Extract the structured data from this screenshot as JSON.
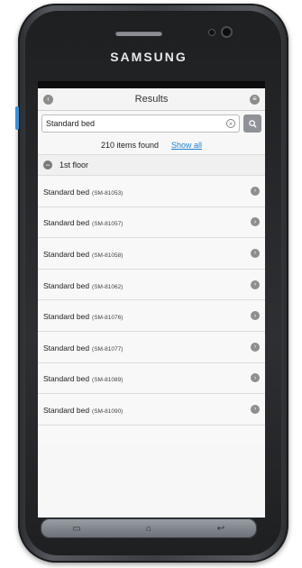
{
  "device": {
    "brand": "SAMSUNG"
  },
  "header": {
    "title": "Results"
  },
  "search": {
    "value": "Standard bed"
  },
  "results": {
    "count_text": "210 items found",
    "show_all": "Show all"
  },
  "section": {
    "title": "1st floor"
  },
  "items": [
    {
      "label": "Standard bed",
      "code": "(SM-81053)"
    },
    {
      "label": "Standard bed",
      "code": "(SM-81057)"
    },
    {
      "label": "Standard bed",
      "code": "(SM-81058)"
    },
    {
      "label": "Standard bed",
      "code": "(SM-81062)"
    },
    {
      "label": "Standard bed",
      "code": "(SM-81076)"
    },
    {
      "label": "Standard bed",
      "code": "(SM-81077)"
    },
    {
      "label": "Standard bed",
      "code": "(SM-81089)"
    },
    {
      "label": "Standard bed",
      "code": "(SM-81090)"
    }
  ],
  "icons": {
    "back": "back-icon",
    "menu": "menu-icon",
    "clear": "clear-icon",
    "search": "search-icon",
    "collapse": "minus-circle-icon",
    "chevron": "chevron-right-icon"
  },
  "colors": {
    "link": "#1f7fd0",
    "screen_bg": "#f7f7f7"
  }
}
